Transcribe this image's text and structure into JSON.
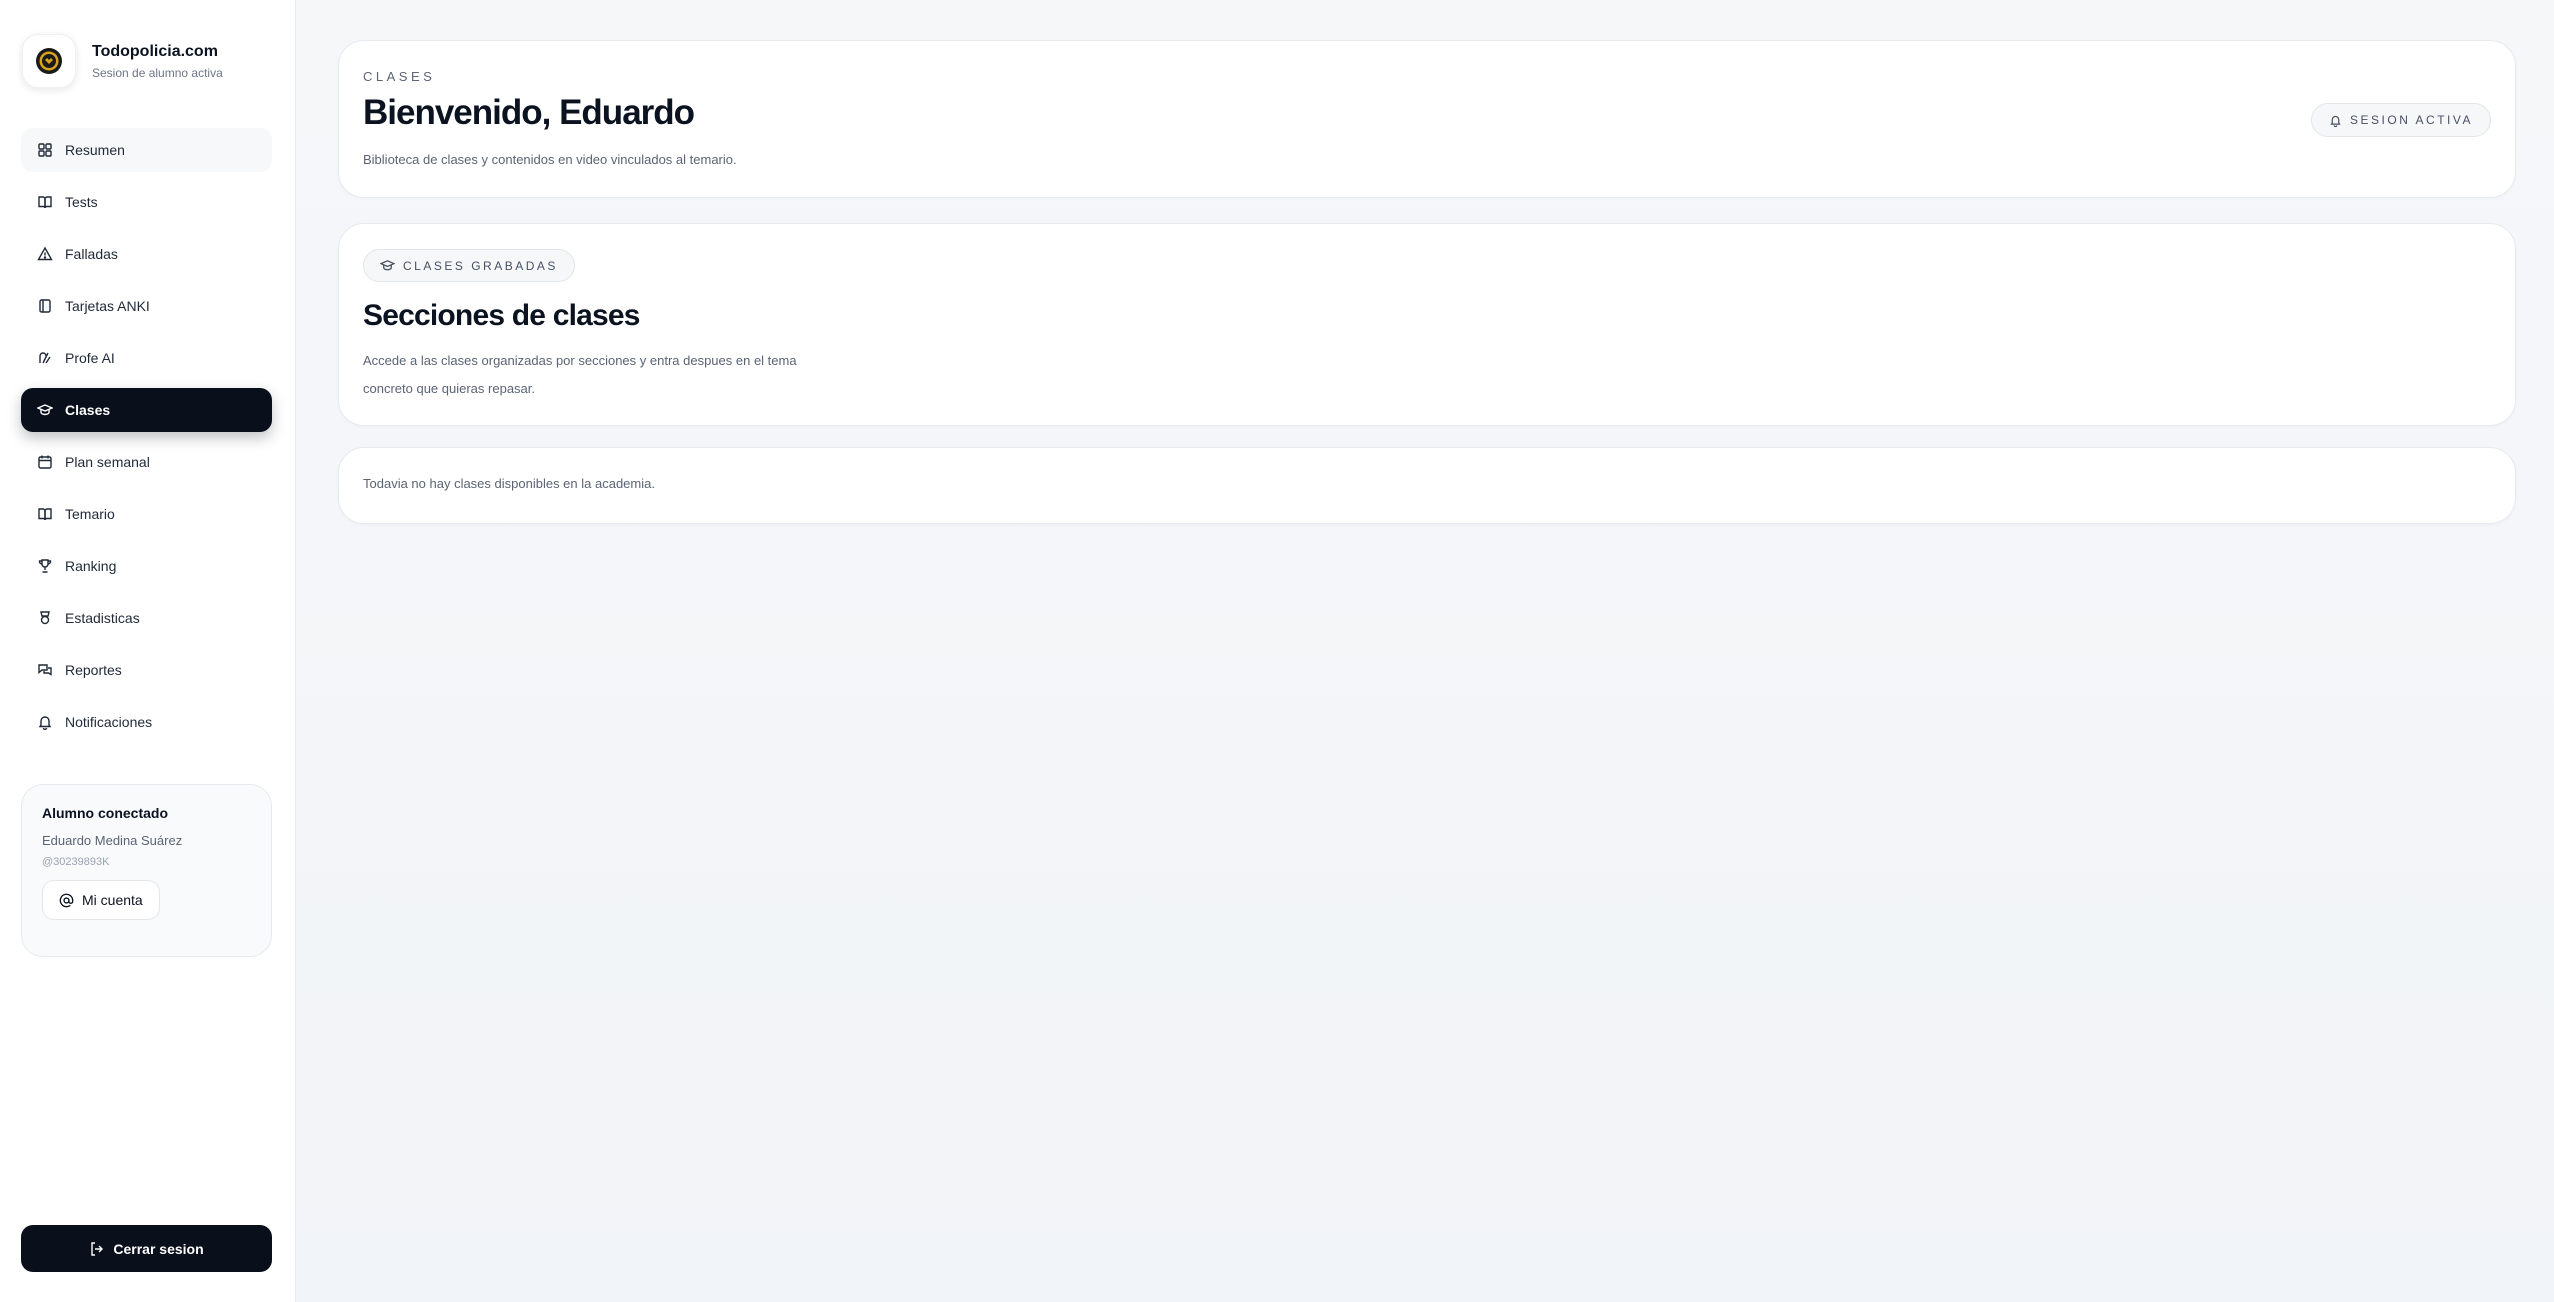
{
  "brand": {
    "title": "Todopolicia.com",
    "subtitle": "Sesion de alumno activa"
  },
  "sidebar": {
    "items": [
      {
        "label": "Resumen",
        "icon": "grid-icon"
      },
      {
        "label": "Tests",
        "icon": "book-icon"
      },
      {
        "label": "Falladas",
        "icon": "warning-icon"
      },
      {
        "label": "Tarjetas ANKI",
        "icon": "cards-icon"
      },
      {
        "label": "Profe AI",
        "icon": "ai-icon"
      },
      {
        "label": "Clases",
        "icon": "graduation-cap-icon",
        "active": true
      },
      {
        "label": "Plan semanal",
        "icon": "calendar-icon"
      },
      {
        "label": "Temario",
        "icon": "book-icon"
      },
      {
        "label": "Ranking",
        "icon": "trophy-icon"
      },
      {
        "label": "Estadisticas",
        "icon": "award-icon"
      },
      {
        "label": "Reportes",
        "icon": "messages-icon"
      },
      {
        "label": "Notificaciones",
        "icon": "bell-icon"
      }
    ],
    "user_card": {
      "heading": "Alumno conectado",
      "name": "Eduardo Medina Suárez",
      "handle": "@30239893K",
      "account_label": "Mi cuenta"
    },
    "logout_label": "Cerrar sesion"
  },
  "header": {
    "eyebrow": "CLASES",
    "title": "Bienvenido, Eduardo",
    "description": "Biblioteca de clases y contenidos en video vinculados al temario.",
    "session_badge": "SESION ACTIVA"
  },
  "sections": {
    "tag": "CLASES GRABADAS",
    "title": "Secciones de clases",
    "description": "Accede a las clases organizadas por secciones y entra despues en el tema concreto que quieras repasar."
  },
  "empty_state": {
    "message": "Todavia no hay clases disponibles en la academia."
  },
  "colors": {
    "active_nav_bg": "#0a0f1c",
    "text_primary": "#0b1220",
    "text_muted": "#5b6474",
    "page_bg": "#f6f7f9"
  }
}
